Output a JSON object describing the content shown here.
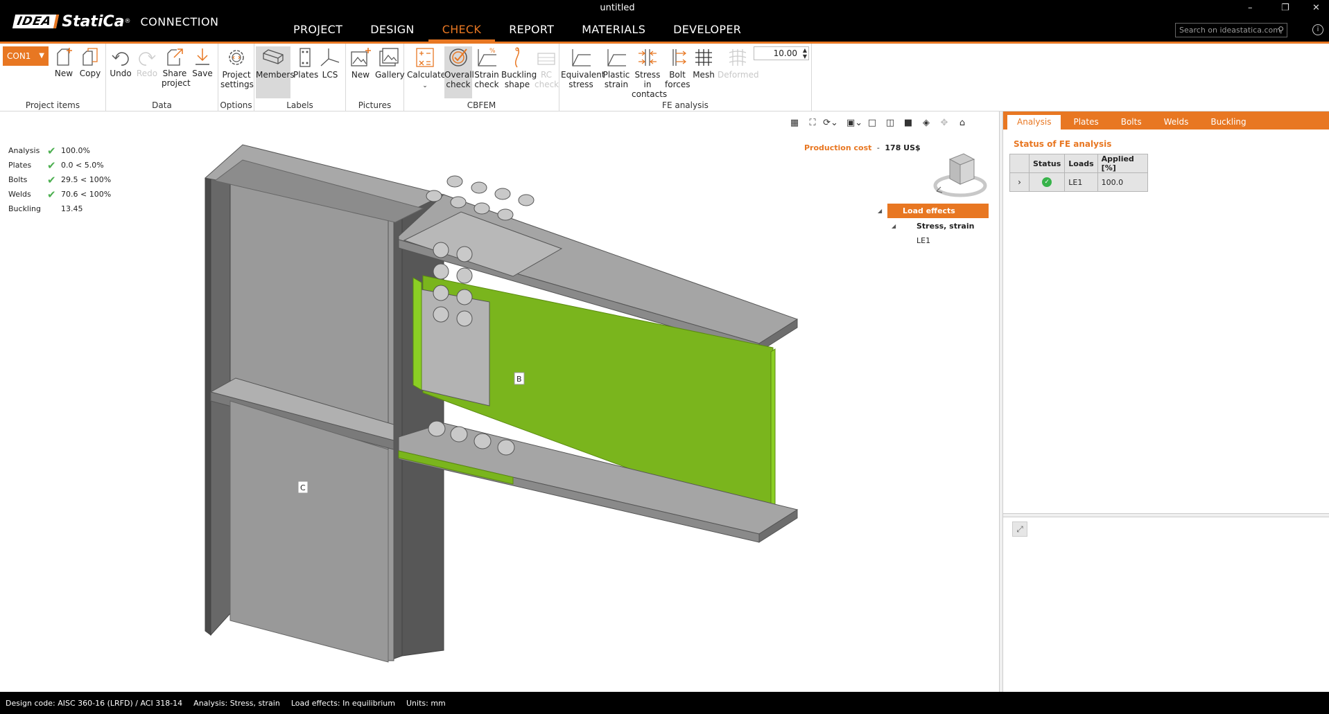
{
  "titlebar": {
    "logo_idea": "IDEA",
    "logo_statica": "StatiCa",
    "logo_reg": "®",
    "product": "CONNECTION",
    "window_title": "untitled",
    "nav": [
      "PROJECT",
      "DESIGN",
      "CHECK",
      "REPORT",
      "MATERIALS",
      "DEVELOPER"
    ],
    "active_nav": "CHECK",
    "search_placeholder": "Search on ideastatica.com",
    "window_controls": [
      "–",
      "❐",
      "✕"
    ]
  },
  "ribbon": {
    "connection_select": "CON1",
    "groups": {
      "project_items": "Project items",
      "data": "Data",
      "options": "Options",
      "labels": "Labels",
      "pictures": "Pictures",
      "cbfem": "CBFEM",
      "fe_analysis": "FE analysis"
    },
    "buttons": {
      "new": "New",
      "copy": "Copy",
      "undo": "Undo",
      "redo": "Redo",
      "share_1": "Share",
      "share_2": "project",
      "save": "Save",
      "project_settings_1": "Project",
      "project_settings_2": "settings",
      "members": "Members",
      "plates": "Plates",
      "lcs": "LCS",
      "pic_new": "New",
      "gallery": "Gallery",
      "calculate": "Calculate",
      "overall_check_1": "Overall",
      "overall_check_2": "check",
      "strain_check_1": "Strain",
      "strain_check_2": "check",
      "buckling_shape_1": "Buckling",
      "buckling_shape_2": "shape",
      "rc_check_1": "RC",
      "rc_check_2": "check",
      "equivalent_stress_1": "Equivalent",
      "equivalent_stress_2": "stress",
      "plastic_strain_1": "Plastic",
      "plastic_strain_2": "strain",
      "stress_in_contacts_1": "Stress in",
      "stress_in_contacts_2": "contacts",
      "bolt_forces_1": "Bolt",
      "bolt_forces_2": "forces",
      "mesh": "Mesh",
      "deformed": "Deformed"
    },
    "deformation_scale": "10.00"
  },
  "viewport": {
    "results": [
      {
        "label": "Analysis",
        "value": "100.0%",
        "ok": true
      },
      {
        "label": "Plates",
        "value": "0.0 < 5.0%",
        "ok": true
      },
      {
        "label": "Bolts",
        "value": "29.5 < 100%",
        "ok": true
      },
      {
        "label": "Welds",
        "value": "70.6 < 100%",
        "ok": true
      },
      {
        "label": "Buckling",
        "value": "13.45",
        "ok": false
      }
    ],
    "production_cost_label": "Production cost",
    "production_cost_sep": "-",
    "production_cost_value": "178 US$",
    "member_labels": {
      "beam": "B",
      "column": "C"
    },
    "tree": {
      "root": "Load effects",
      "child": "Stress, strain",
      "leaf": "LE1"
    }
  },
  "right_panel": {
    "tabs": [
      "Analysis",
      "Plates",
      "Bolts",
      "Welds",
      "Buckling"
    ],
    "active_tab": "Analysis",
    "title": "Status of FE analysis",
    "table": {
      "headers": [
        "Status",
        "Loads",
        "Applied [%]"
      ],
      "rows": [
        {
          "loads": "LE1",
          "applied": "100.0"
        }
      ]
    }
  },
  "statusbar": {
    "design_code": "Design code: AISC 360-16 (LRFD) / ACI 318-14",
    "analysis": "Analysis: Stress, strain",
    "load_effects": "Load effects: In equilibrium",
    "units": "Units: mm"
  },
  "colors": {
    "accent": "#e87722",
    "ok": "#4caf50",
    "weld_green": "#7ab51d"
  }
}
